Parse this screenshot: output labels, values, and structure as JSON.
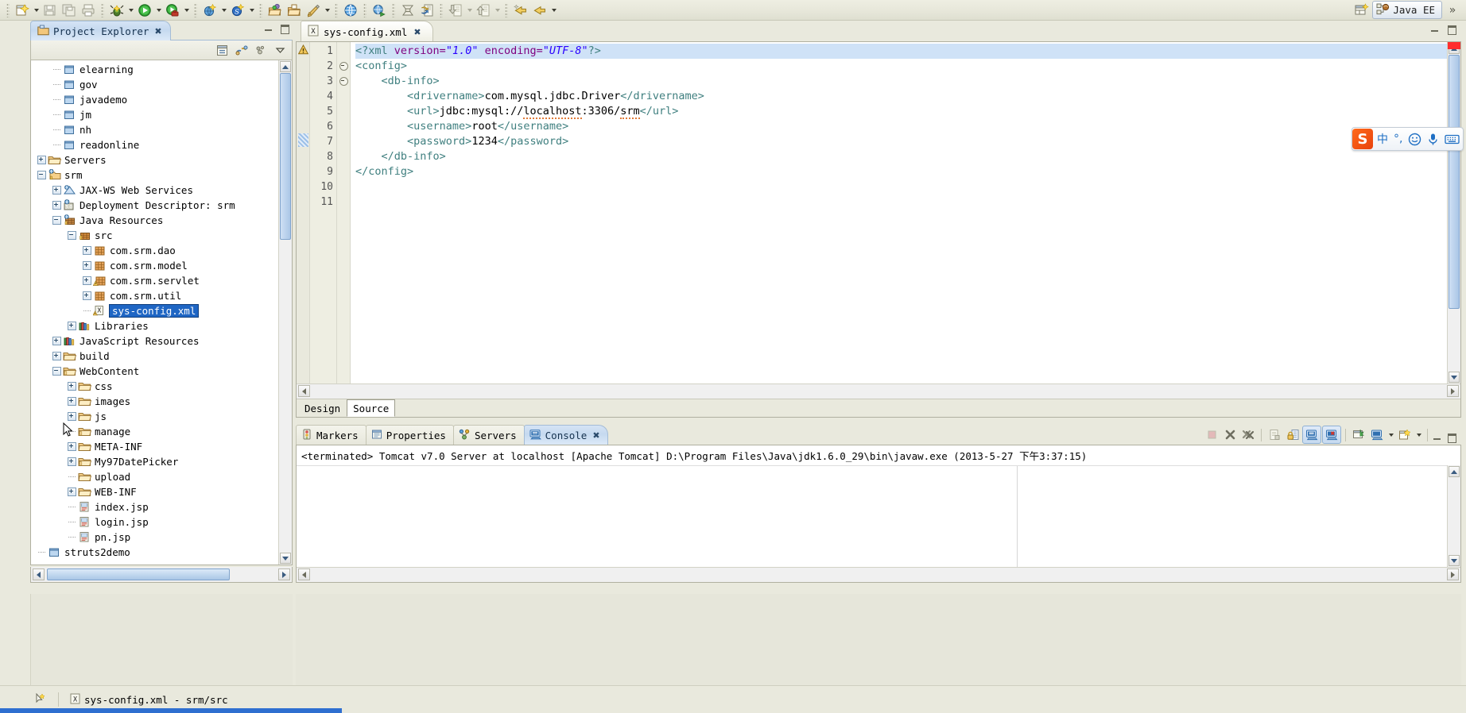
{
  "app": {
    "perspective_label": "Java EE",
    "perspective_overflow": "»"
  },
  "toolbar": {
    "groups": [
      {
        "items": [
          {
            "name": "new-wizard-icon",
            "label": "New",
            "has_arrow": true
          },
          {
            "name": "save-icon",
            "label": "Save",
            "has_arrow": false
          },
          {
            "name": "save-all-icon",
            "label": "Save All",
            "has_arrow": false
          },
          {
            "name": "print-icon",
            "label": "Print",
            "has_arrow": false
          }
        ]
      },
      {
        "items": [
          {
            "name": "debug-icon",
            "label": "Debug",
            "has_arrow": true
          },
          {
            "name": "run-icon",
            "label": "Run",
            "has_arrow": true
          },
          {
            "name": "run-external-tools-icon",
            "label": "External Tools",
            "has_arrow": true
          }
        ]
      },
      {
        "items": [
          {
            "name": "new-web-service-icon",
            "label": "New Web Service",
            "has_arrow": true
          },
          {
            "name": "new-server-icon",
            "label": "New Server",
            "has_arrow": true
          }
        ]
      },
      {
        "items": [
          {
            "name": "open-type-icon",
            "label": "Open Type",
            "has_arrow": false
          },
          {
            "name": "open-resource-icon",
            "label": "Open Resource",
            "has_arrow": false
          },
          {
            "name": "new-java-package-icon",
            "label": "New Java Package",
            "has_arrow": true
          }
        ]
      },
      {
        "items": [
          {
            "name": "web-browser-icon",
            "label": "Open Web Browser",
            "has_arrow": false
          }
        ]
      },
      {
        "items": [
          {
            "name": "run-web-service-icon",
            "label": "Test Web Service",
            "has_arrow": false
          }
        ]
      },
      {
        "items": [
          {
            "name": "deploy-icon",
            "label": "Deploy",
            "has_arrow": false
          },
          {
            "name": "publish-icon",
            "label": "Publish",
            "has_arrow": false
          }
        ]
      },
      {
        "items": [
          {
            "name": "import-icon",
            "label": "Import",
            "has_arrow": true
          },
          {
            "name": "export-icon",
            "label": "Export",
            "has_arrow": true
          }
        ]
      },
      {
        "items": [
          {
            "name": "back-history-icon",
            "label": "Back",
            "has_arrow": false
          },
          {
            "name": "forward-history-icon",
            "label": "Forward",
            "has_arrow": true
          }
        ]
      },
      {
        "items": [
          {
            "name": "previous-annotation-icon",
            "label": "Previous Annotation",
            "has_arrow": true
          },
          {
            "name": "next-annotation-icon",
            "label": "Next Annotation",
            "has_arrow": true
          }
        ]
      }
    ]
  },
  "explorer": {
    "tab_label": "Project Explorer",
    "tab_close": "✖",
    "toolbar_buttons": [
      {
        "name": "collapse-all-icon",
        "label": "Collapse All"
      },
      {
        "name": "link-with-editor-icon",
        "label": "Link with Editor"
      },
      {
        "name": "view-menu-icon",
        "label": "View Menu"
      },
      {
        "name": "view-dropdown-icon",
        "label": "Minimize"
      }
    ],
    "tree": [
      {
        "indent": 1,
        "twisty": "none",
        "icon": "project-closed-icon",
        "label": "elearning"
      },
      {
        "indent": 1,
        "twisty": "none",
        "icon": "project-closed-icon",
        "label": "gov"
      },
      {
        "indent": 1,
        "twisty": "none",
        "icon": "project-closed-icon",
        "label": "javademo"
      },
      {
        "indent": 1,
        "twisty": "none",
        "icon": "project-closed-icon",
        "label": "jm"
      },
      {
        "indent": 1,
        "twisty": "none",
        "icon": "project-closed-icon",
        "label": "nh"
      },
      {
        "indent": 1,
        "twisty": "none",
        "icon": "project-closed-icon",
        "label": "readonline"
      },
      {
        "indent": 0,
        "twisty": "plus",
        "icon": "folder-icon",
        "label": "Servers"
      },
      {
        "indent": 0,
        "twisty": "minus",
        "icon": "web-project-icon",
        "label": "srm"
      },
      {
        "indent": 1,
        "twisty": "plus",
        "icon": "web-services-icon",
        "label": "JAX-WS Web Services"
      },
      {
        "indent": 1,
        "twisty": "plus",
        "icon": "deployment-descriptor-icon",
        "label": "Deployment Descriptor: srm"
      },
      {
        "indent": 1,
        "twisty": "minus",
        "icon": "java-resources-icon",
        "label": "Java Resources"
      },
      {
        "indent": 2,
        "twisty": "minus",
        "icon": "source-folder-icon",
        "label": "src"
      },
      {
        "indent": 3,
        "twisty": "plus",
        "icon": "package-icon",
        "label": "com.srm.dao"
      },
      {
        "indent": 3,
        "twisty": "plus",
        "icon": "package-icon",
        "label": "com.srm.model"
      },
      {
        "indent": 3,
        "twisty": "plus",
        "icon": "package-warning-icon",
        "label": "com.srm.servlet"
      },
      {
        "indent": 3,
        "twisty": "plus",
        "icon": "package-icon",
        "label": "com.srm.util"
      },
      {
        "indent": 3,
        "twisty": "none",
        "icon": "xml-file-icon",
        "label": "sys-config.xml",
        "selected": true
      },
      {
        "indent": 2,
        "twisty": "plus",
        "icon": "libraries-icon",
        "label": "Libraries"
      },
      {
        "indent": 1,
        "twisty": "plus",
        "icon": "libraries-icon",
        "label": "JavaScript Resources"
      },
      {
        "indent": 1,
        "twisty": "plus",
        "icon": "folder-icon",
        "label": "build"
      },
      {
        "indent": 1,
        "twisty": "minus",
        "icon": "webcontent-folder-icon",
        "label": "WebContent"
      },
      {
        "indent": 2,
        "twisty": "plus",
        "icon": "folder-icon",
        "label": "css"
      },
      {
        "indent": 2,
        "twisty": "plus",
        "icon": "folder-icon",
        "label": "images"
      },
      {
        "indent": 2,
        "twisty": "plus",
        "icon": "folder-icon",
        "label": "js"
      },
      {
        "indent": 2,
        "twisty": "none",
        "icon": "webcontent-folder-icon",
        "label": "manage",
        "cursor": true
      },
      {
        "indent": 2,
        "twisty": "plus",
        "icon": "folder-icon",
        "label": "META-INF"
      },
      {
        "indent": 2,
        "twisty": "plus",
        "icon": "webcontent-folder-icon",
        "label": "My97DatePicker"
      },
      {
        "indent": 2,
        "twisty": "none",
        "icon": "folder-icon",
        "label": "upload"
      },
      {
        "indent": 2,
        "twisty": "plus",
        "icon": "folder-icon",
        "label": "WEB-INF"
      },
      {
        "indent": 2,
        "twisty": "none",
        "icon": "jsp-file-icon",
        "label": "index.jsp"
      },
      {
        "indent": 2,
        "twisty": "none",
        "icon": "jsp-file-icon",
        "label": "login.jsp"
      },
      {
        "indent": 2,
        "twisty": "none",
        "icon": "jsp-file-icon",
        "label": "pn.jsp"
      },
      {
        "indent": 0,
        "twisty": "none",
        "icon": "project-closed-icon",
        "label": "struts2demo"
      }
    ]
  },
  "editor": {
    "tab_label": "sys-config.xml",
    "tab_close": "✖",
    "bottom_tabs": [
      {
        "label": "Design",
        "active": false
      },
      {
        "label": "Source",
        "active": true
      }
    ],
    "warning_marker": "warning-marker-icon",
    "lines": [
      {
        "num": "1",
        "fold": "none",
        "marker": "warning",
        "tokens": [
          {
            "t": "<?xml ",
            "c": "tag"
          },
          {
            "t": "version=",
            "c": "attr"
          },
          {
            "t": "\"1.0\"",
            "c": "str"
          },
          {
            "t": " encoding=",
            "c": "attr"
          },
          {
            "t": "\"UTF-8\"",
            "c": "str"
          },
          {
            "t": "?>",
            "c": "tag"
          }
        ],
        "highlight": true
      },
      {
        "num": "2",
        "fold": "collapse",
        "tokens": [
          {
            "t": "<config>",
            "c": "tag"
          }
        ]
      },
      {
        "num": "3",
        "fold": "collapse",
        "tokens": [
          {
            "t": "    <db-info>",
            "c": "tag"
          }
        ]
      },
      {
        "num": "4",
        "fold": "none",
        "tokens": [
          {
            "t": "        <drivername>",
            "c": "tag"
          },
          {
            "t": "com.mysql.jdbc.Driver",
            "c": "txt"
          },
          {
            "t": "</drivername>",
            "c": "tag"
          }
        ]
      },
      {
        "num": "5",
        "fold": "none",
        "tokens": [
          {
            "t": "        <url>",
            "c": "tag"
          },
          {
            "t": "jdbc:mysql://",
            "c": "txt"
          },
          {
            "t": "localhost",
            "c": "txt-squig"
          },
          {
            "t": ":3306/",
            "c": "txt"
          },
          {
            "t": "srm",
            "c": "txt-squig"
          },
          {
            "t": "</url>",
            "c": "tag"
          }
        ]
      },
      {
        "num": "6",
        "fold": "none",
        "tokens": [
          {
            "t": "        <username>",
            "c": "tag"
          },
          {
            "t": "root",
            "c": "txt"
          },
          {
            "t": "</username>",
            "c": "tag"
          }
        ]
      },
      {
        "num": "7",
        "fold": "none",
        "marker": "change",
        "tokens": [
          {
            "t": "        <password>",
            "c": "tag"
          },
          {
            "t": "1234",
            "c": "txt"
          },
          {
            "t": "</password>",
            "c": "tag"
          }
        ]
      },
      {
        "num": "8",
        "fold": "none",
        "tokens": [
          {
            "t": "    </db-info>",
            "c": "tag"
          }
        ]
      },
      {
        "num": "9",
        "fold": "none",
        "tokens": [
          {
            "t": "</config>",
            "c": "tag"
          }
        ]
      },
      {
        "num": "10",
        "fold": "none",
        "tokens": []
      },
      {
        "num": "11",
        "fold": "none",
        "tokens": []
      }
    ]
  },
  "console": {
    "tabs": [
      {
        "label": "Markers",
        "icon": "markers-icon",
        "active": false
      },
      {
        "label": "Properties",
        "icon": "properties-icon",
        "active": false
      },
      {
        "label": "Servers",
        "icon": "servers-icon",
        "active": false
      },
      {
        "label": "Console",
        "icon": "console-icon",
        "active": true,
        "close": "✖"
      }
    ],
    "status_line": "<terminated> Tomcat v7.0 Server at localhost [Apache Tomcat] D:\\Program Files\\Java\\jdk1.6.0_29\\bin\\javaw.exe  (2013-5-27 下午3:37:15)",
    "tools": [
      {
        "name": "terminate-icon",
        "label": "Terminate",
        "pressed": false,
        "disabled": true
      },
      {
        "name": "remove-launch-icon",
        "label": "Remove Launch",
        "pressed": false
      },
      {
        "name": "remove-all-terminated-icon",
        "label": "Remove All Terminated Launches",
        "pressed": false
      },
      {
        "name": "clear-console-icon",
        "label": "Clear Console",
        "pressed": false,
        "disabled": true
      },
      {
        "name": "scroll-lock-icon",
        "label": "Scroll Lock",
        "pressed": false
      },
      {
        "name": "show-console-standard-out-icon",
        "label": "Show Console When Standard Out Changes",
        "pressed": true
      },
      {
        "name": "show-console-standard-error-icon",
        "label": "Show Console When Standard Error Changes",
        "pressed": true
      },
      {
        "name": "pin-console-icon",
        "label": "Pin Console",
        "pressed": false
      },
      {
        "name": "display-selected-console-icon",
        "label": "Display Selected Console",
        "pressed": false,
        "has_arrow": true
      },
      {
        "name": "open-console-icon",
        "label": "Open Console",
        "pressed": false,
        "has_arrow": true
      }
    ]
  },
  "status_bar": {
    "selection_icon": "selection-mode-icon",
    "resource_label": "sys-config.xml - srm/src"
  },
  "ime": {
    "logo": "S",
    "items": [
      {
        "name": "ime-mode-chinese",
        "label": "中"
      },
      {
        "name": "ime-punctuation",
        "label": "°,"
      },
      {
        "name": "ime-emoji-icon",
        "label": "☺"
      },
      {
        "name": "ime-voice-icon",
        "label": "🎤"
      },
      {
        "name": "ime-keyboard-icon",
        "label": "⌨"
      }
    ]
  }
}
